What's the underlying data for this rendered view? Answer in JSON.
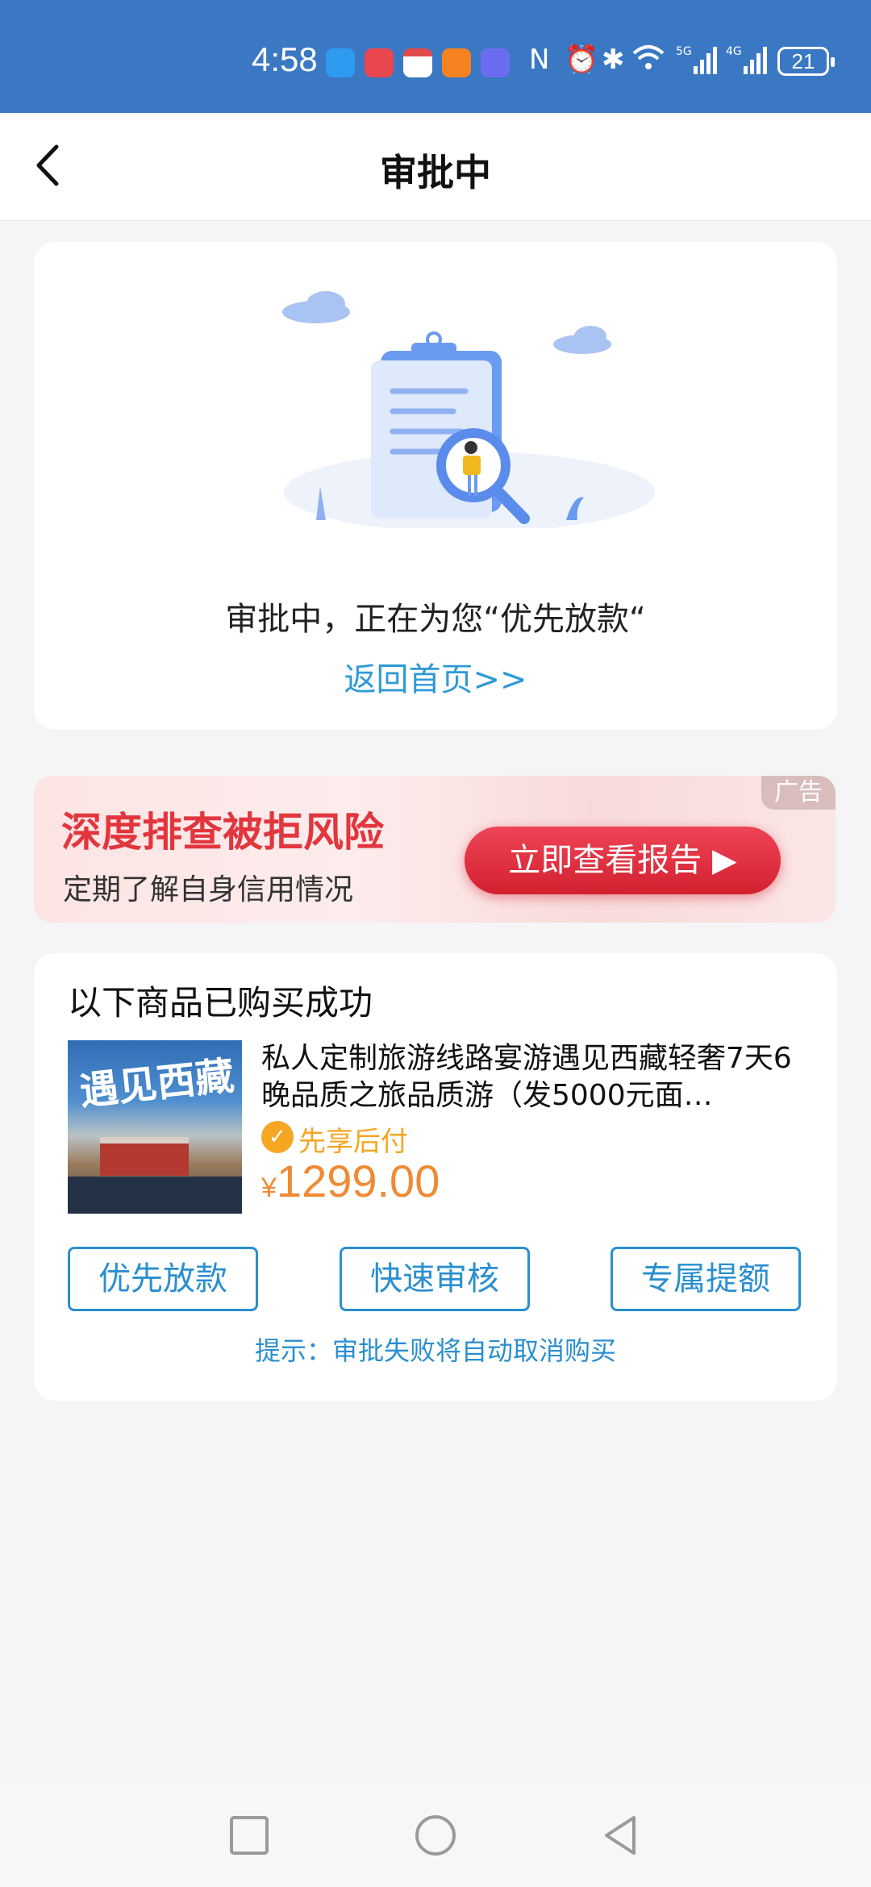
{
  "status_bar": {
    "time": "4:58",
    "battery": "21",
    "icons": [
      "message-app-icon",
      "book-app-icon",
      "calendar-app-icon",
      "taobao-app-icon",
      "music-app-icon",
      "nfc-icon",
      "alarm-icon",
      "bluetooth-icon",
      "wifi-icon",
      "signal-5g-icon",
      "signal-4g-icon"
    ],
    "color": "#3a78c4"
  },
  "nav": {
    "title": "审批中"
  },
  "status_card": {
    "message": "审批中，正在为您“优先放款“",
    "home_link": "返回首页>>"
  },
  "ad": {
    "headline": "深度排查被拒风险",
    "subtitle": "定期了解自身信用情况",
    "cta": "立即查看报告 ▶",
    "badge": "广告"
  },
  "purchase": {
    "title": "以下商品已购买成功",
    "product": {
      "name": "私人定制旅游线路宴游遇见西藏轻奢7天6晚品质之旅品质游（发5000元面…",
      "image_text": "遇见西藏",
      "tag": "先享后付",
      "currency": "¥",
      "price": "1299.00"
    },
    "actions": [
      "优先放款",
      "快速审核",
      "专属提额"
    ],
    "tip": "提示：审批失败将自动取消购买"
  },
  "colors": {
    "accent_blue": "#2a8fcf",
    "price_orange": "#ef8b35",
    "ad_red": "#e2363e"
  }
}
